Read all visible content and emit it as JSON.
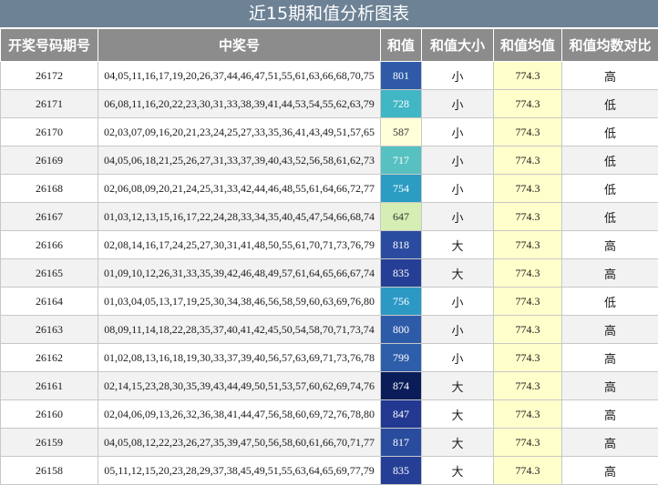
{
  "title": "近15期和值分析图表",
  "headers": [
    "开奖号码期号",
    "中奖号",
    "和值",
    "和值大小",
    "和值均值",
    "和值均数对比"
  ],
  "rows": [
    {
      "issue": "26172",
      "numbers": "04,05,11,16,17,19,20,26,37,44,46,47,51,55,61,63,66,68,70,75",
      "sum": "801",
      "size": "小",
      "avg": "774.3",
      "cmp": "高",
      "sum_color": "#2e5aa8"
    },
    {
      "issue": "26171",
      "numbers": "06,08,11,16,20,22,23,30,31,33,38,39,41,44,53,54,55,62,63,79",
      "sum": "728",
      "size": "小",
      "avg": "774.3",
      "cmp": "低",
      "sum_color": "#41b6c4"
    },
    {
      "issue": "26170",
      "numbers": "02,03,07,09,16,20,21,23,24,25,27,33,35,36,41,43,49,51,57,65",
      "sum": "587",
      "size": "小",
      "avg": "774.3",
      "cmp": "低",
      "sum_color": "#ffffd9"
    },
    {
      "issue": "26169",
      "numbers": "04,05,06,18,21,25,26,27,31,33,37,39,40,43,52,56,58,61,62,73",
      "sum": "717",
      "size": "小",
      "avg": "774.3",
      "cmp": "低",
      "sum_color": "#57c0c0"
    },
    {
      "issue": "26168",
      "numbers": "02,06,08,09,20,21,24,25,31,33,42,44,46,48,55,61,64,66,72,77",
      "sum": "754",
      "size": "小",
      "avg": "774.3",
      "cmp": "低",
      "sum_color": "#2b9cc2"
    },
    {
      "issue": "26167",
      "numbers": "01,03,12,13,15,16,17,22,24,28,33,34,35,40,45,47,54,66,68,74",
      "sum": "647",
      "size": "小",
      "avg": "774.3",
      "cmp": "低",
      "sum_color": "#d4eeb3"
    },
    {
      "issue": "26166",
      "numbers": "02,08,14,16,17,24,25,27,30,31,41,48,50,55,61,70,71,73,76,79",
      "sum": "818",
      "size": "大",
      "avg": "774.3",
      "cmp": "高",
      "sum_color": "#2a4b9f"
    },
    {
      "issue": "26165",
      "numbers": "01,09,10,12,26,31,33,35,39,42,46,48,49,57,61,64,65,66,67,74",
      "sum": "835",
      "size": "大",
      "avg": "774.3",
      "cmp": "高",
      "sum_color": "#253f96"
    },
    {
      "issue": "26164",
      "numbers": "01,03,04,05,13,17,19,25,30,34,38,46,56,58,59,60,63,69,76,80",
      "sum": "756",
      "size": "小",
      "avg": "774.3",
      "cmp": "低",
      "sum_color": "#2c99c5"
    },
    {
      "issue": "26163",
      "numbers": "08,09,11,14,18,22,28,35,37,40,41,42,45,50,54,58,70,71,73,74",
      "sum": "800",
      "size": "小",
      "avg": "774.3",
      "cmp": "高",
      "sum_color": "#2e5ba8"
    },
    {
      "issue": "26162",
      "numbers": "01,02,08,13,16,18,19,30,33,37,39,40,56,57,63,69,71,73,76,78",
      "sum": "799",
      "size": "小",
      "avg": "774.3",
      "cmp": "高",
      "sum_color": "#2e5da9"
    },
    {
      "issue": "26161",
      "numbers": "02,14,15,23,28,30,35,39,43,44,49,50,51,53,57,60,62,69,74,76",
      "sum": "874",
      "size": "大",
      "avg": "774.3",
      "cmp": "高",
      "sum_color": "#0b1d59"
    },
    {
      "issue": "26160",
      "numbers": "02,04,06,09,13,26,32,36,38,41,44,47,56,58,60,69,72,76,78,80",
      "sum": "847",
      "size": "大",
      "avg": "774.3",
      "cmp": "高",
      "sum_color": "#233891"
    },
    {
      "issue": "26159",
      "numbers": "04,05,08,12,22,23,26,27,35,39,47,50,56,58,60,61,66,70,71,77",
      "sum": "817",
      "size": "大",
      "avg": "774.3",
      "cmp": "高",
      "sum_color": "#2a4c9f"
    },
    {
      "issue": "26158",
      "numbers": "05,11,12,15,20,23,28,29,37,38,45,49,51,55,63,64,65,69,77,79",
      "sum": "835",
      "size": "大",
      "avg": "774.3",
      "cmp": "高",
      "sum_color": "#253f96"
    }
  ]
}
